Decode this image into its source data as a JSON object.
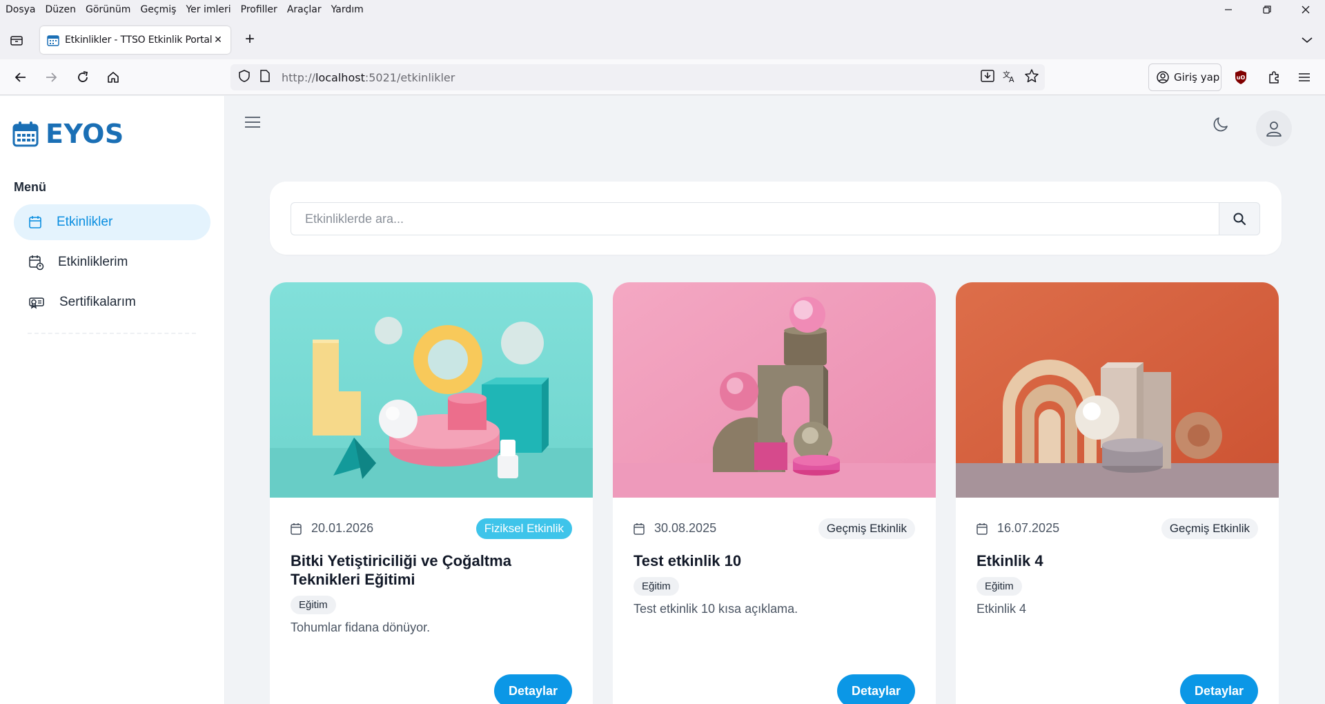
{
  "browser": {
    "menu": [
      "Dosya",
      "Düzen",
      "Görünüm",
      "Geçmiş",
      "Yer imleri",
      "Profiller",
      "Araçlar",
      "Yardım"
    ],
    "tab_title": "Etkinlikler - TTSO Etkinlik Portalı",
    "url": {
      "scheme": "http://",
      "host": "localhost",
      "rest": ":5021/etkinlikler"
    },
    "signin_label": "Giriş yap"
  },
  "app": {
    "logo_text": "EYOS",
    "menu_heading": "Menü",
    "sidebar": [
      {
        "label": "Etkinlikler",
        "icon": "calendar-icon",
        "active": true
      },
      {
        "label": "Etkinliklerim",
        "icon": "calendar-user-icon",
        "active": false
      },
      {
        "label": "Sertifikalarım",
        "icon": "certificate-icon",
        "active": false
      }
    ],
    "search": {
      "placeholder": "Etkinliklerde ara..."
    },
    "events": [
      {
        "date": "20.01.2026",
        "status": "Fiziksel Etkinlik",
        "title": "Bitki Yetiştiriciliği ve Çoğaltma Teknikleri Eğitimi",
        "category": "Eğitim",
        "description": "Tohumlar fidana dönüyor.",
        "button": "Detaylar"
      },
      {
        "date": "30.08.2025",
        "status": "Geçmiş Etkinlik",
        "title": "Test etkinlik 10",
        "category": "Eğitim",
        "description": "Test etkinlik 10 kısa açıklama.",
        "button": "Detaylar"
      },
      {
        "date": "16.07.2025",
        "status": "Geçmiş Etkinlik",
        "title": "Etkinlik 4",
        "category": "Eğitim",
        "description": "Etkinlik 4",
        "button": "Detaylar"
      }
    ],
    "colors": {
      "accent": "#0b97e6",
      "logo": "#1a6fb5",
      "badge_live": "#3ec4ea",
      "active_bg": "#e4f3fd"
    }
  }
}
